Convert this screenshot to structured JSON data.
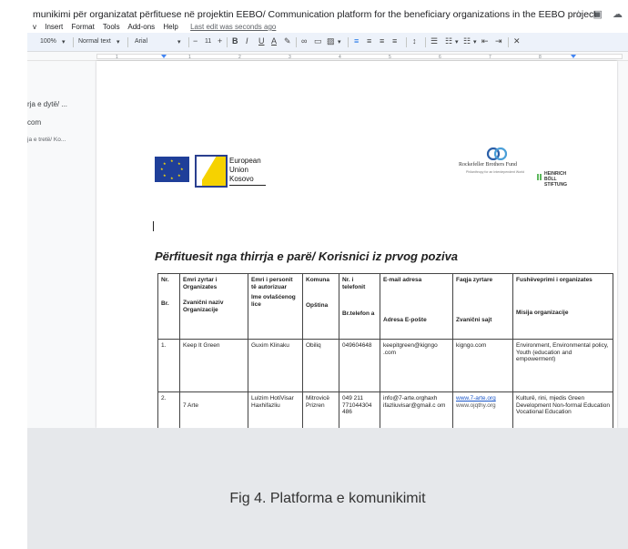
{
  "title_bar": {
    "doc_title": "munikimi për organizatat përfituese në projektin EEBO/ Communication platform for the beneficiary organizations in the EEBO project",
    "icons": [
      "star-icon",
      "folder-move-icon",
      "cloud-status-icon"
    ]
  },
  "menu": {
    "items": [
      "v",
      "Insert",
      "Format",
      "Tools",
      "Add-ons",
      "Help"
    ],
    "last_edit": "Last edit was seconds ago"
  },
  "toolbar": {
    "zoom": "100%",
    "style": "Normal text",
    "font": "Arial",
    "minus": "−",
    "font_size": "11",
    "plus": "+",
    "bold": "B",
    "italic": "I",
    "underline": "U",
    "text_color": "A"
  },
  "ruler": {
    "numbers": [
      "1",
      "1",
      "2",
      "3",
      "4",
      "5",
      "6",
      "7",
      "8"
    ]
  },
  "outline": {
    "items": [
      "rja e dytë/ ...",
      "com",
      "ja e tretë/ Ko..."
    ]
  },
  "logos": {
    "eu_line1": "European",
    "eu_line2": "Union",
    "eu_line3": "Kosovo",
    "rbf_name": "Rockefeller Brothers Fund",
    "rbf_tag": "Philanthropy for an Interdependent World",
    "hb_line1": "HEINRICH",
    "hb_line2": "BÖLL",
    "hb_line3": "STIFTUNG"
  },
  "heading": "Përfituesit nga thirrja e parë/ Korisnici iz prvog poziva",
  "table": {
    "headers": [
      {
        "top": "Nr.",
        "bottom": "Br."
      },
      {
        "top": "Emri zyrtar i Organizates",
        "bottom": "Zvanični naziv Organizacije"
      },
      {
        "top": "Emri i personit të autorizuar",
        "bottom": "Ime ovlašćenog lice"
      },
      {
        "top": "Komuna",
        "bottom": "Opština"
      },
      {
        "top": "Nr. i telefonit",
        "bottom": "Br.telefon a"
      },
      {
        "top": "E-mail adresa",
        "bottom": "Adresa E-pošte"
      },
      {
        "top": "Faqja zyrtare",
        "bottom": "Zvanični sajt"
      },
      {
        "top": "Fushëveprimi i organizates",
        "bottom": "Misija organizacije"
      }
    ],
    "rows": [
      {
        "nr": "1.",
        "name": "Keep It Green",
        "person": "Guxim Klinaku",
        "municipality": "Obiliq",
        "phone": "049604648",
        "email": "keepitgreen@kigngo .com",
        "website": "kigngo.com",
        "website2": "",
        "mission": "Environment, Environmental policy, Youth (education and empowerment)"
      },
      {
        "nr": "2.",
        "name": "7 Arte",
        "person": "Lulzim HotiVisar Haxhifazliu",
        "municipality": "Mitrovicë Prizren",
        "phone": "049 211 771044304 486",
        "email": "info@7-arte.orghaxh ifazliuvisar@gmail.c om",
        "website": "www.7-arte.org",
        "website2": "www.ojqthy.org",
        "mission": "Kulturë, rini, mjedis Green Development Non-formal Education Vocational Education"
      }
    ]
  },
  "caption": "Fig 4. Platforma e komunikimit"
}
